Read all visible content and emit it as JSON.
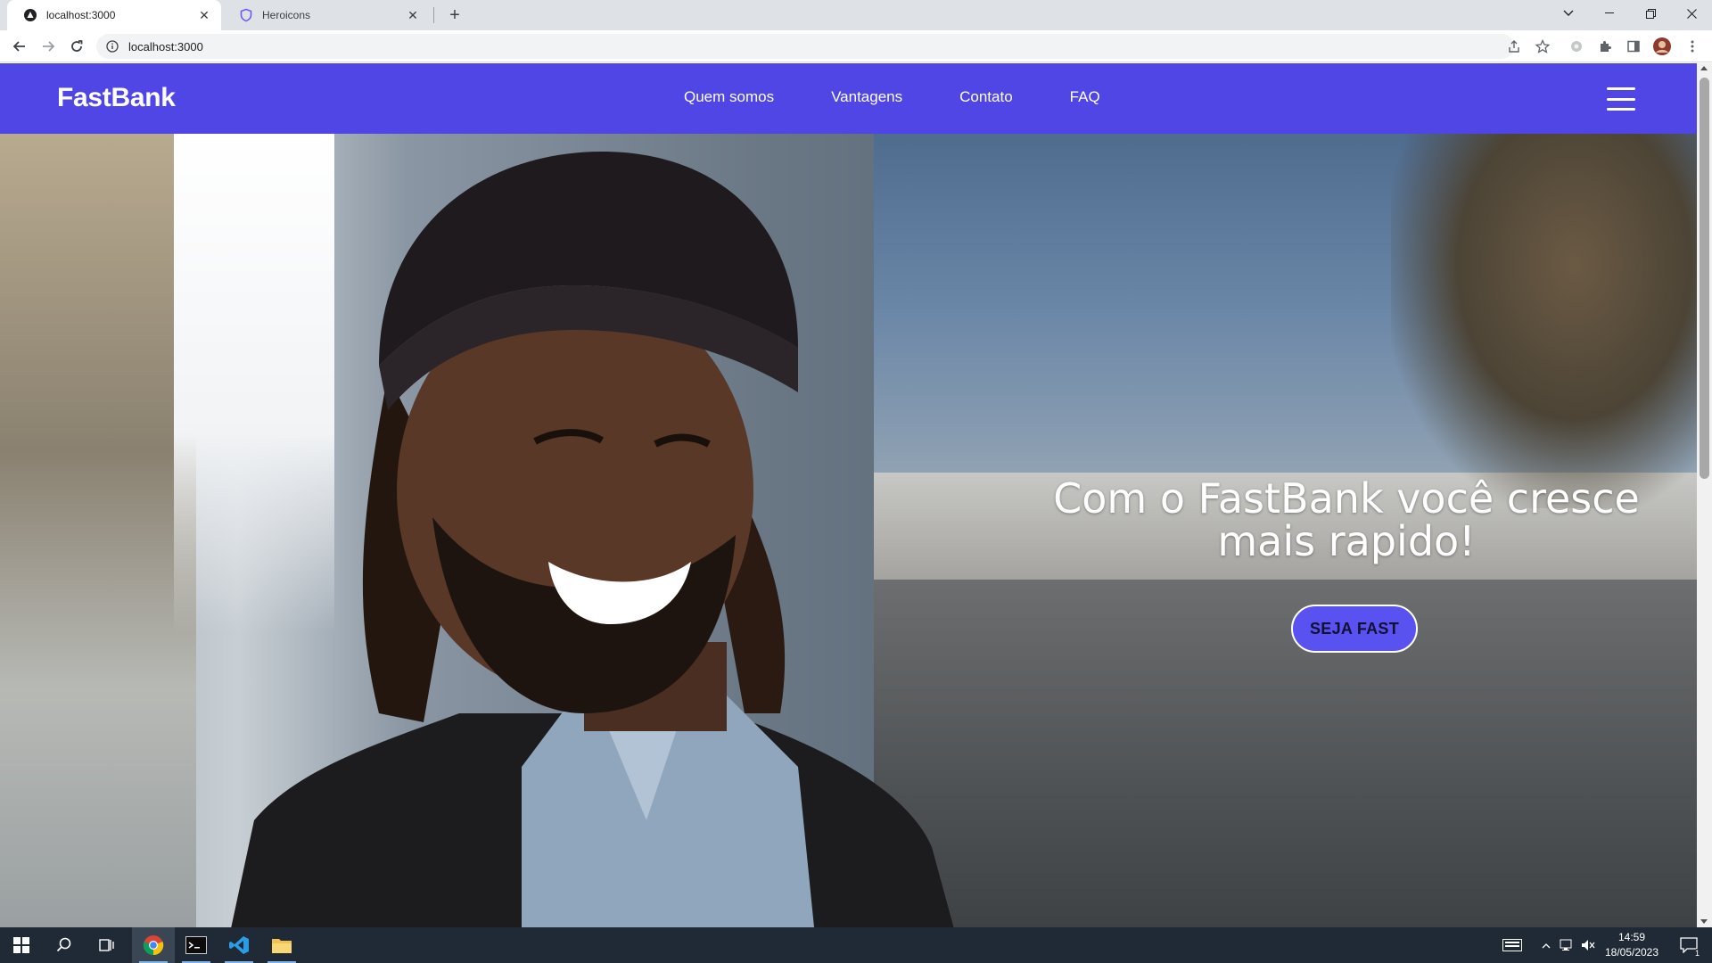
{
  "browser": {
    "tabs": [
      {
        "title": "localhost:3000",
        "active": true,
        "favicon": "site-icon"
      },
      {
        "title": "Heroicons",
        "active": false,
        "favicon": "shield-icon"
      }
    ],
    "address_bar": {
      "url": "localhost:3000",
      "icon": "info-icon"
    },
    "toolbar_icons": [
      "share-icon",
      "star-icon",
      "extension-puzzle-icon",
      "side-panel-icon",
      "profile-avatar",
      "menu-kebab-icon"
    ]
  },
  "site": {
    "brand": "FastBank",
    "nav": [
      "Quem somos",
      "Vantagens",
      "Contato",
      "FAQ"
    ],
    "hero": {
      "headline_line1": "Com o FastBank você cresce",
      "headline_line2": "mais rapido!",
      "cta_label": "SEJA FAST"
    },
    "colors": {
      "navbar": "#4f46e5",
      "cta": "#5a52f0",
      "text": "#ffffff"
    }
  },
  "taskbar": {
    "apps": [
      "windows-start-icon",
      "search-icon",
      "task-view-icon",
      "chrome-icon",
      "terminal-icon",
      "vscode-icon",
      "file-explorer-icon"
    ],
    "clock": {
      "time": "14:59",
      "date": "18/05/2023"
    },
    "notification_count": "1"
  }
}
